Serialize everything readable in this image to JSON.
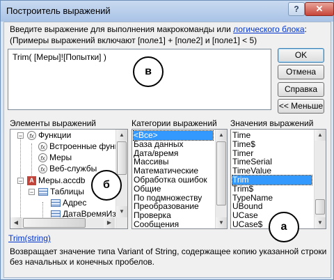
{
  "window": {
    "title": "Построитель выражений",
    "help_btn": "?",
    "close_btn": "✕"
  },
  "instructions": {
    "line1_before": "Введите выражение для выполнения макрокоманды или ",
    "line1_link": "логического блока",
    "line1_after": ":",
    "line2": "(Примеры выражений включают [поле1] + [поле2] и [поле1] < 5)"
  },
  "expression": {
    "value": "Trim( [Меры]![Попытки] )"
  },
  "buttons": {
    "ok": "OK",
    "cancel": "Отмена",
    "help": "Справка",
    "less": "<< Меньше"
  },
  "panels": {
    "elements_label": "Элементы выражений",
    "categories_label": "Категории выражений",
    "values_label": "Значения выражений"
  },
  "tree": [
    {
      "label": "Функции",
      "expander": "−",
      "icon": "function-icon"
    },
    {
      "label": "Встроенные функ",
      "icon": "function-icon"
    },
    {
      "label": "Меры",
      "icon": "function-icon"
    },
    {
      "label": "Веб-службы",
      "icon": "function-icon"
    },
    {
      "label": "Меры.accdb",
      "expander": "−",
      "icon": "access-db-icon"
    },
    {
      "label": "Таблицы",
      "expander": "−",
      "icon": "table-icon"
    },
    {
      "label": "Адрес",
      "icon": "table-icon"
    },
    {
      "label": "ДатаВремяИзм",
      "icon": "table-icon"
    }
  ],
  "categories": {
    "items": [
      "<Все>",
      "База данных",
      "Дата/время",
      "Массивы",
      "Математические",
      "Обработка ошибок",
      "Общие",
      "По подмножеству",
      "Преобразование",
      "Проверка",
      "Сообщения"
    ],
    "selected": "<Все>"
  },
  "values": {
    "items": [
      "Time",
      "Time$",
      "Timer",
      "TimeSerial",
      "TimeValue",
      "Trim",
      "Trim$",
      "TypeName",
      "UBound",
      "UCase",
      "UCase$"
    ],
    "selected": "Trim"
  },
  "help_function": "Trim(string)",
  "description": "Возвращает значение типа Variant of String, содержащее копию указанной строки без начальных и конечных пробелов.",
  "markers": {
    "a": "а",
    "b": "б",
    "v": "в"
  },
  "colors": {
    "selection": "#3399ff",
    "link": "#0033cc",
    "titlebar": "#b6cdeb"
  }
}
